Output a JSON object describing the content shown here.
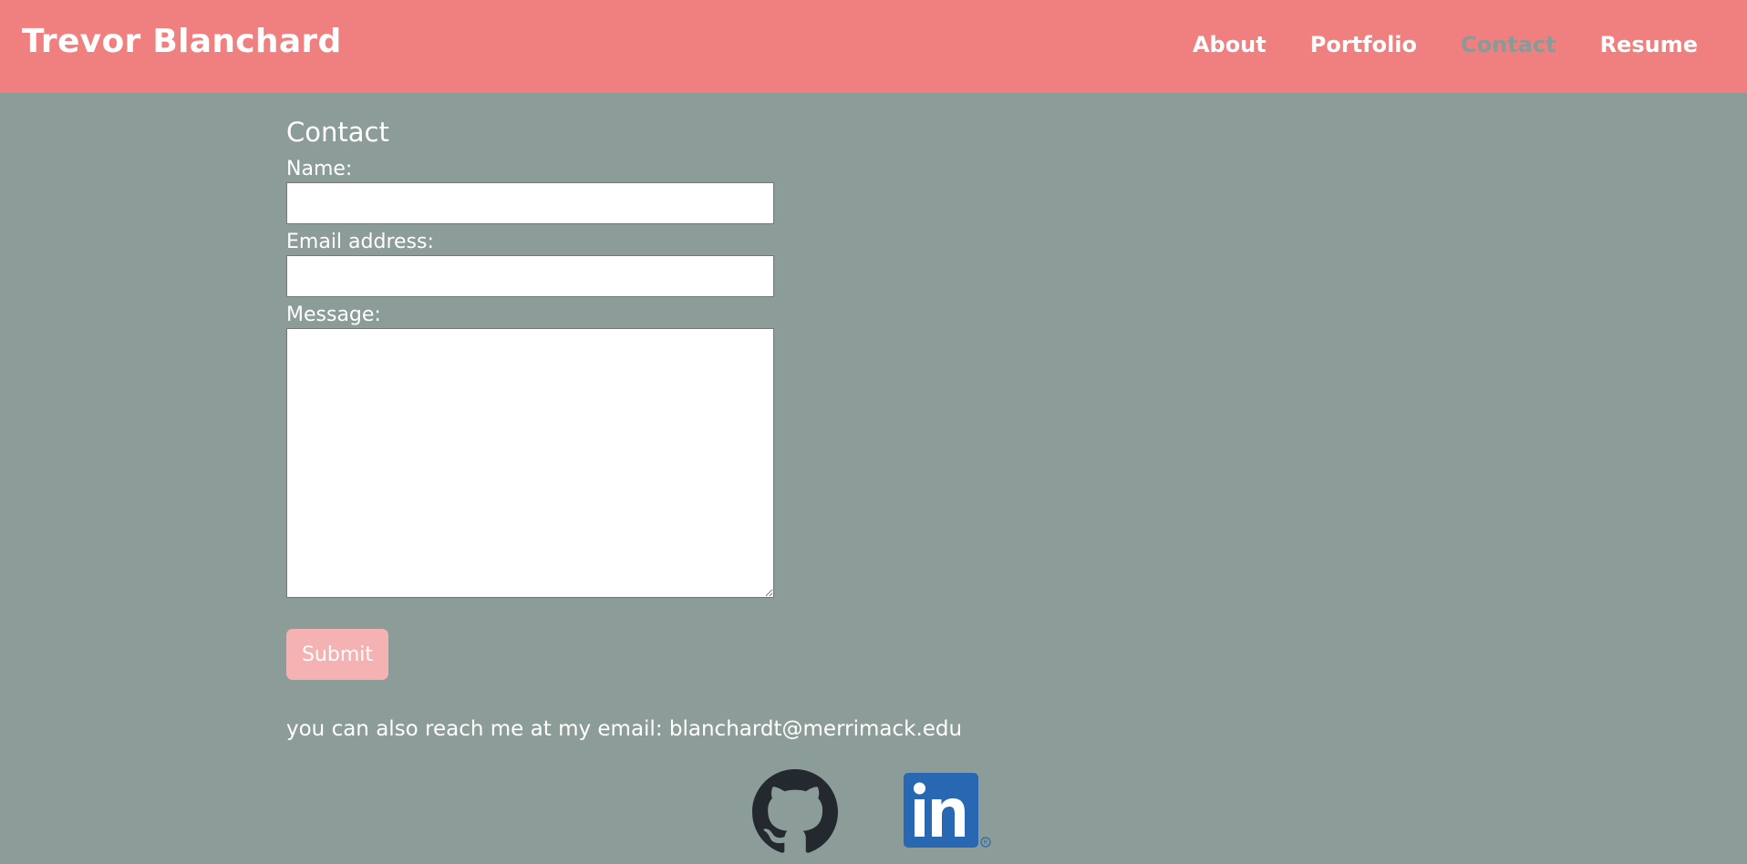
{
  "header": {
    "brand": "Trevor Blanchard",
    "nav": [
      {
        "label": "About"
      },
      {
        "label": "Portfolio"
      },
      {
        "label": "Contact"
      },
      {
        "label": "Resume"
      }
    ],
    "active_nav": "Contact"
  },
  "contact": {
    "title": "Contact",
    "name_label": "Name:",
    "name_value": "",
    "email_label": "Email address:",
    "email_value": "",
    "message_label": "Message:",
    "message_value": "",
    "submit_label": "Submit",
    "email_note": "you can also reach me at my email: blanchardt@merrimack.edu"
  },
  "social": [
    {
      "icon": "github-icon"
    },
    {
      "icon": "linkedin-icon"
    }
  ],
  "colors": {
    "header_bg": "#f07f7f",
    "page_bg": "#8c9c98",
    "submit_bg": "#f4b2b2",
    "linkedin_blue": "#2867b2"
  }
}
